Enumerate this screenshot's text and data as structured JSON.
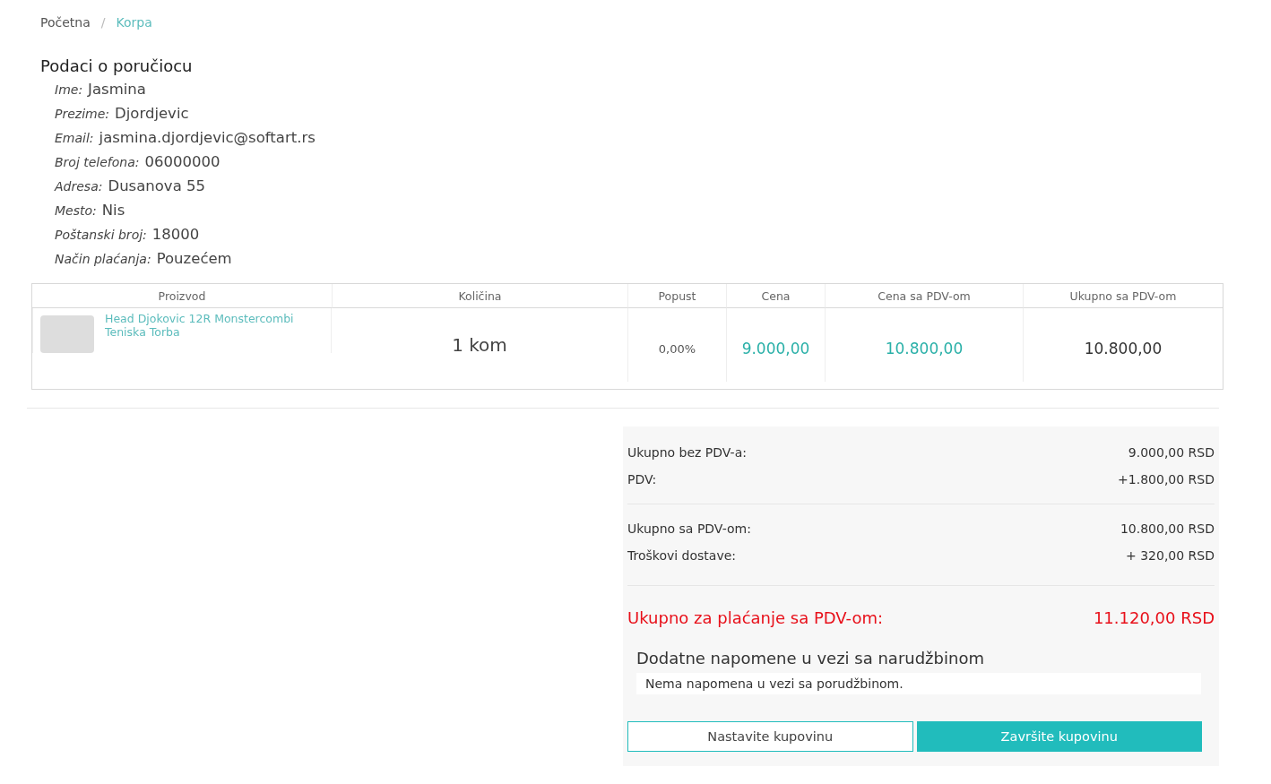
{
  "breadcrumb_separator": "/",
  "breadcrumb": [
    {
      "label": "Početna",
      "selected": false
    },
    {
      "label": "Korpa",
      "selected": true
    }
  ],
  "customer": {
    "title": "Podaci o poručiocu",
    "fields": [
      {
        "label": "Ime:",
        "value": "Jasmina"
      },
      {
        "label": "Prezime:",
        "value": "Djordjevic"
      },
      {
        "label": "Email:",
        "value": "jasmina.djordjevic@softart.rs"
      },
      {
        "label": "Broj telefona:",
        "value": "06000000"
      },
      {
        "label": "Adresa:",
        "value": "Dusanova 55"
      },
      {
        "label": "Mesto:",
        "value": "Nis"
      },
      {
        "label": "Poštanski broj:",
        "value": "18000"
      },
      {
        "label": "Način plaćanja:",
        "value": "Pouzećem"
      }
    ]
  },
  "cart_table": {
    "columns": [
      "Proizvod",
      "Količina",
      "Popust",
      "Cena",
      "Cena sa PDV-om",
      "Ukupno sa PDV-om"
    ],
    "rows": [
      {
        "product": "Head Djokovic 12R Monstercombi Teniska Torba",
        "quantity": "1 kom",
        "discount": "0,00%",
        "price": "9.000,00",
        "price_with_vat": "10.800,00",
        "total": "10.800,00"
      }
    ]
  },
  "summary": {
    "groups": [
      [
        {
          "label": "Ukupno bez PDV-a:",
          "value": "9.000,00 RSD"
        },
        {
          "label": "PDV:",
          "value": "+1.800,00 RSD"
        }
      ],
      [
        {
          "label": "Ukupno sa PDV-om:",
          "value": "10.800,00 RSD"
        },
        {
          "label": "Troškovi dostave:",
          "value": "+ 320,00 RSD"
        }
      ]
    ],
    "grand_total": {
      "label": "Ukupno za plaćanje sa PDV-om:",
      "value": "11.120,00 RSD"
    },
    "notes_title": "Dodatne napomene u vezi sa narudžbinom",
    "notes": "Nema napomena u vezi sa porudžbinom.",
    "buttons": [
      {
        "label": "Nastavite kupovinu",
        "kind": "outline"
      },
      {
        "label": "Završite kupovinu",
        "kind": "primary"
      }
    ]
  }
}
